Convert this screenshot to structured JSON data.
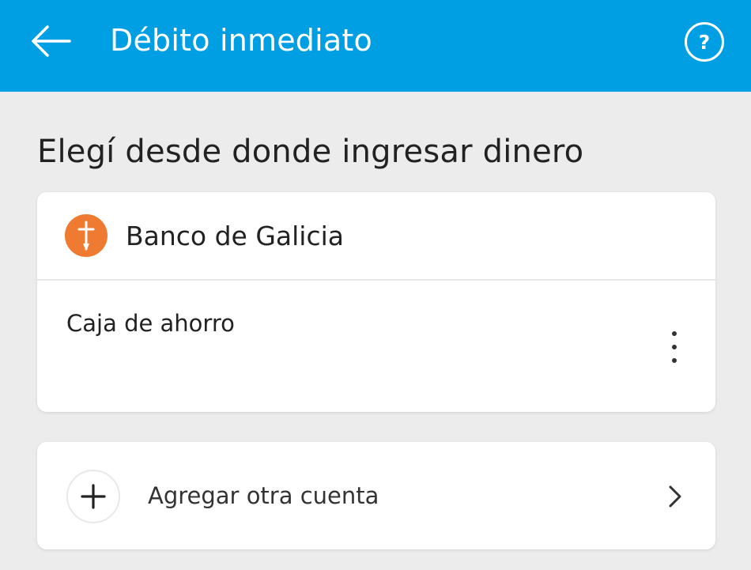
{
  "appbar": {
    "title": "Débito inmediato",
    "back_icon": "arrow-left-icon",
    "help_icon": "help-circle-icon",
    "help_glyph": "?"
  },
  "section": {
    "title": "Elegí desde donde ingresar dinero"
  },
  "bank": {
    "name": "Banco de Galicia",
    "logo_icon": "galicia-logo-icon",
    "logo_color": "#ee7b31",
    "account": {
      "type": "Caja de ahorro",
      "menu_icon": "more-vertical-icon"
    }
  },
  "add_account": {
    "label": "Agregar otra cuenta",
    "plus_icon": "plus-icon",
    "chevron_icon": "chevron-right-icon"
  },
  "colors": {
    "primary": "#009ee3",
    "background": "#ececec",
    "card": "#ffffff",
    "text": "#222222"
  }
}
